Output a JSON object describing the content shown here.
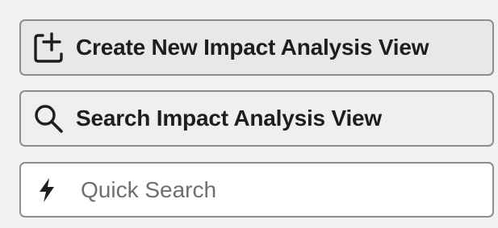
{
  "actions": {
    "create_label": "Create New Impact Analysis View",
    "create_icon": "add-view-icon",
    "search_label": "Search Impact Analysis View",
    "search_icon": "search-icon"
  },
  "quick_search": {
    "placeholder": "Quick Search",
    "value": "",
    "icon": "lightning-bolt-icon"
  },
  "colors": {
    "background": "#f1f1f1",
    "button_border": "#8d8d8d",
    "text": "#1e1e1e",
    "placeholder": "#6f6f6f"
  }
}
